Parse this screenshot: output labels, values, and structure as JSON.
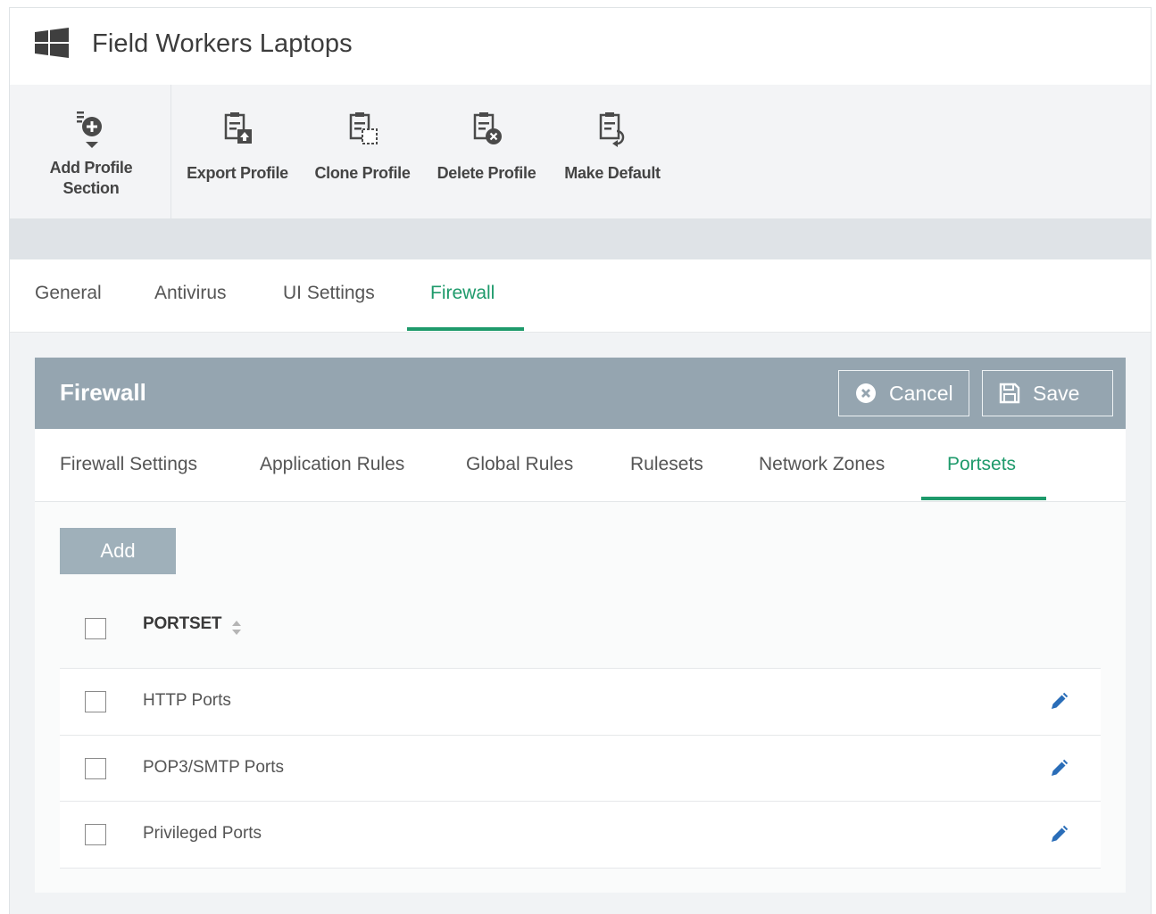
{
  "header": {
    "title": "Field Workers Laptops",
    "logo_icon": "windows-logo-icon"
  },
  "toolbar": {
    "items": [
      {
        "label": "Add Profile Section",
        "icon": "add-section-icon"
      },
      {
        "label": "Export Profile",
        "icon": "export-icon"
      },
      {
        "label": "Clone Profile",
        "icon": "clone-icon"
      },
      {
        "label": "Delete Profile",
        "icon": "delete-icon"
      },
      {
        "label": "Make Default",
        "icon": "make-default-icon"
      }
    ]
  },
  "main_tabs": {
    "items": [
      "General",
      "Antivirus",
      "UI Settings",
      "Firewall"
    ],
    "active": "Firewall"
  },
  "panel": {
    "title": "Firewall",
    "cancel_label": "Cancel",
    "save_label": "Save"
  },
  "sub_tabs": {
    "items": [
      "Firewall Settings",
      "Application Rules",
      "Global Rules",
      "Rulesets",
      "Network Zones",
      "Portsets"
    ],
    "active": "Portsets"
  },
  "content": {
    "add_label": "Add",
    "column_header": "PORTSET",
    "rows": [
      {
        "name": "HTTP Ports"
      },
      {
        "name": "POP3/SMTP Ports"
      },
      {
        "name": "Privileged Ports"
      }
    ]
  },
  "colors": {
    "accent": "#1e9a6b",
    "panel_header": "#95a5b0",
    "add_button": "#9fb0ba",
    "edit_icon": "#2a6db8"
  }
}
